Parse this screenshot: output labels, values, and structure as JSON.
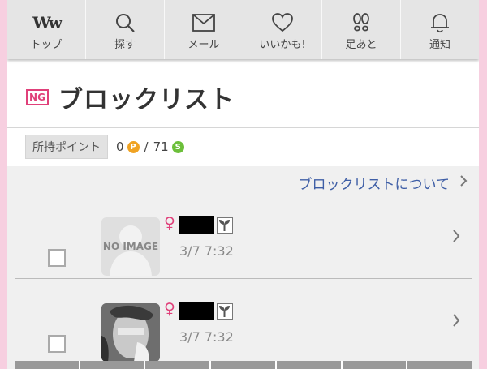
{
  "nav": {
    "items": [
      {
        "label": "トップ",
        "icon": "ww-logo-icon",
        "logo_text": "Ww"
      },
      {
        "label": "探す",
        "icon": "search-icon"
      },
      {
        "label": "メール",
        "icon": "mail-icon"
      },
      {
        "label": "いいかも!",
        "icon": "heart-icon"
      },
      {
        "label": "足あと",
        "icon": "footprint-icon"
      },
      {
        "label": "通知",
        "icon": "bell-icon"
      }
    ]
  },
  "header": {
    "badge": "NG",
    "title": "ブロックリスト"
  },
  "points": {
    "label": "所持ポイント",
    "p_value": "0",
    "p_coin": "P",
    "s_value": "71",
    "s_coin": "S",
    "separator": "/"
  },
  "about_link": "ブロックリストについて",
  "rows": [
    {
      "thumb_text": "NO IMAGE",
      "time": "3/7 7:32",
      "gender_symbol": "♀"
    },
    {
      "thumb_text": "",
      "time": "3/7 7:32",
      "gender_symbol": "♀"
    }
  ],
  "colors": {
    "background": "#f7cfe0",
    "accent_pink": "#e0407a",
    "link_blue": "#3e5ea6",
    "point_coin": "#f0a323",
    "s_coin": "#6cbf3a"
  }
}
